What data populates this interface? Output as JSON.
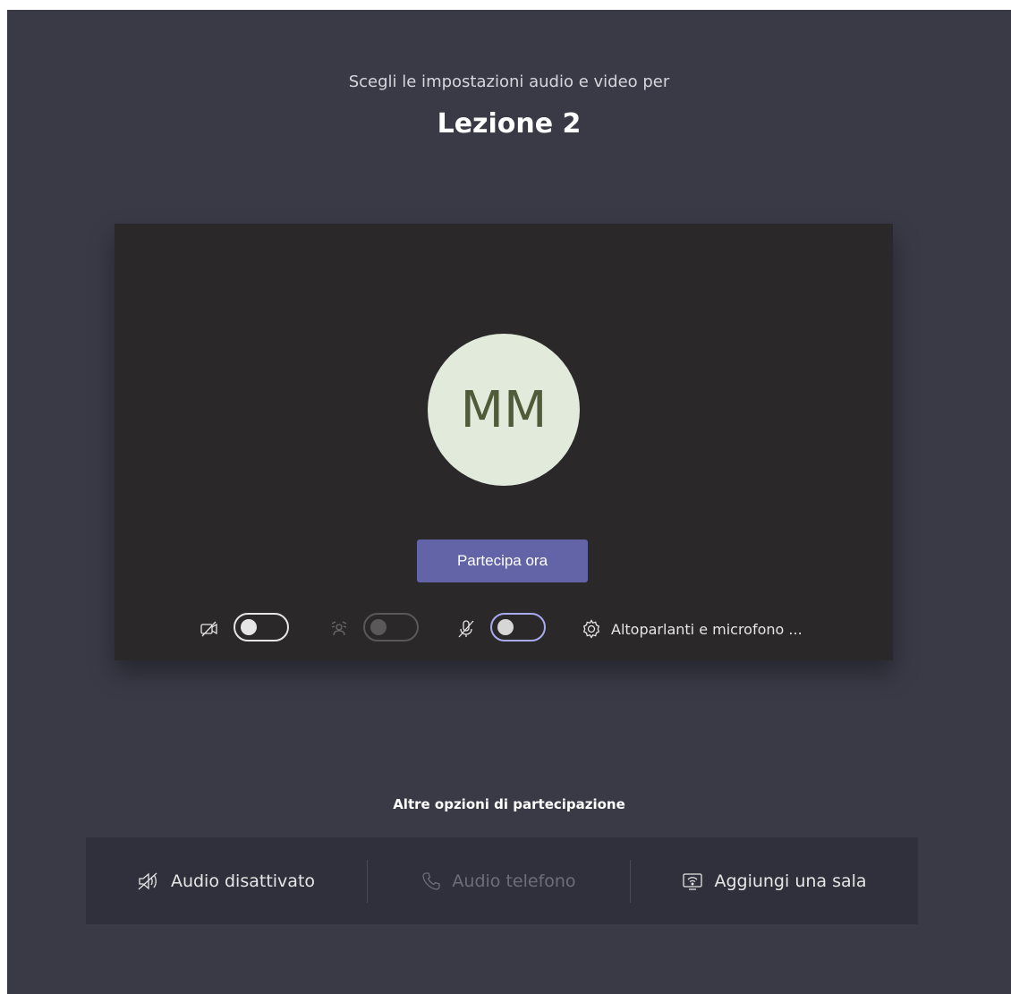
{
  "header": {
    "subtitle": "Scegli le impostazioni audio e video per",
    "meeting_title": "Lezione 2"
  },
  "preview": {
    "avatar_initials": "MM",
    "join_button_label": "Partecipa ora",
    "camera_toggle": {
      "icon": "camera-off-icon",
      "state": "off"
    },
    "background_blur_toggle": {
      "icon": "background-blur-icon",
      "state": "off",
      "disabled": true
    },
    "microphone_toggle": {
      "icon": "mic-off-icon",
      "state": "off",
      "focused": true
    },
    "device_settings_label": "Altoparlanti e microfono ...",
    "device_settings_icon": "gear-icon"
  },
  "more_options": {
    "heading": "Altre opzioni di partecipazione",
    "items": [
      {
        "label": "Audio disattivato",
        "icon": "speaker-off-icon",
        "disabled": false
      },
      {
        "label": "Audio telefono",
        "icon": "phone-icon",
        "disabled": true
      },
      {
        "label": "Aggiungi una sala",
        "icon": "room-cast-icon",
        "disabled": false
      }
    ]
  },
  "colors": {
    "background": "#3a3a47",
    "preview_background": "#2a2828",
    "accent": "#6264a7",
    "avatar_bg": "#e2eadc",
    "avatar_text": "#505b3a"
  }
}
